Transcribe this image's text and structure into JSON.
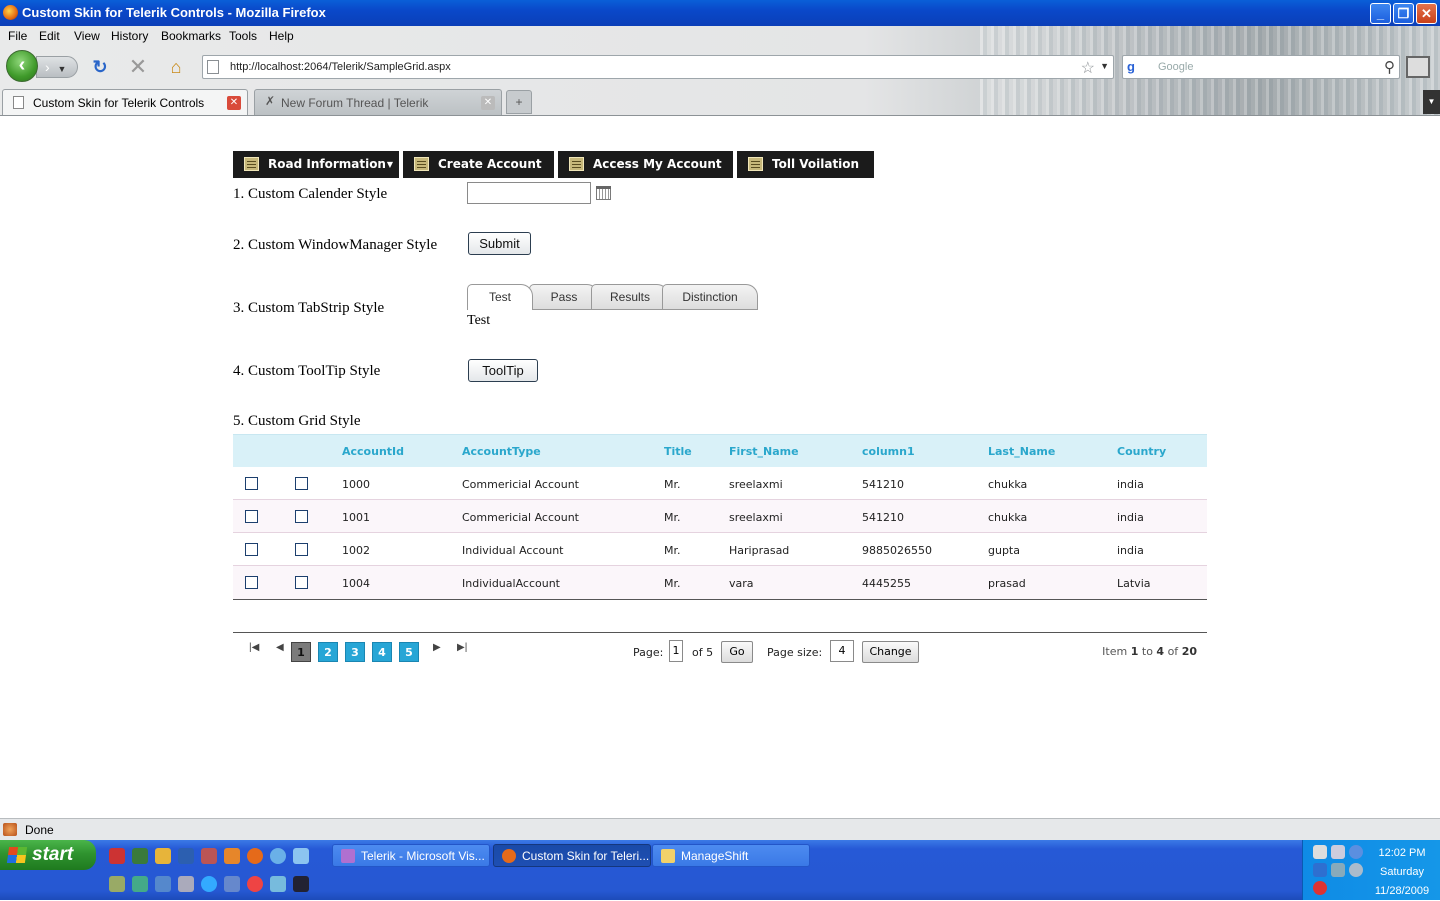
{
  "window": {
    "title": "Custom Skin for Telerik Controls - Mozilla Firefox",
    "minimize": "_",
    "maximize": "❐",
    "close": "✕"
  },
  "menubar": [
    "File",
    "Edit",
    "View",
    "History",
    "Bookmarks",
    "Tools",
    "Help"
  ],
  "navbar": {
    "url": "http://localhost:2064/Telerik/SampleGrid.aspx",
    "search_placeholder": "Google"
  },
  "tabs": [
    {
      "label": "Custom Skin for Telerik Controls",
      "active": true
    },
    {
      "label": "New Forum Thread | Telerik",
      "active": false
    }
  ],
  "nav_menu": [
    {
      "label": "Road Information",
      "has_dropdown": true
    },
    {
      "label": "Create Account",
      "has_dropdown": false
    },
    {
      "label": "Access My Account",
      "has_dropdown": false
    },
    {
      "label": "Toll Voilation",
      "has_dropdown": false
    }
  ],
  "sections": {
    "calendar_label": "1. Custom Calender Style",
    "calendar_value": "",
    "window_label": "2. Custom WindowManager Style",
    "submit_label": "Submit",
    "tabstrip_label": "3. Custom TabStrip Style",
    "tabstrip_tabs": [
      "Test",
      "Pass",
      "Results",
      "Distinction"
    ],
    "tabstrip_selected": "Test",
    "tabstrip_content": "Test",
    "tooltip_label": "4. Custom ToolTip Style",
    "tooltip_button": "ToolTip",
    "grid_label": "5. Custom Grid Style"
  },
  "grid": {
    "columns": [
      "AccountId",
      "AccountType",
      "Title",
      "First_Name",
      "column1",
      "Last_Name",
      "Country"
    ],
    "rows": [
      [
        "1000",
        "Commericial Account",
        "Mr.",
        "sreelaxmi",
        "541210",
        "chukka",
        "india"
      ],
      [
        "1001",
        "Commericial Account",
        "Mr.",
        "sreelaxmi",
        "541210",
        "chukka",
        "india"
      ],
      [
        "1002",
        "Individual Account",
        "Mr.",
        "Hariprasad",
        "9885026550",
        "gupta",
        "india"
      ],
      [
        "1004",
        "IndividualAccount",
        "Mr.",
        "vara",
        "4445255",
        "prasad",
        "Latvia"
      ]
    ]
  },
  "pager": {
    "pages": [
      "1",
      "2",
      "3",
      "4",
      "5"
    ],
    "current_page": "1",
    "page_label": "Page:",
    "page_value": "1",
    "of_text": "of 5",
    "go_label": "Go",
    "page_size_label": "Page size:",
    "page_size_value": "4",
    "change_label": "Change",
    "info_item": "Item",
    "info_from": "1",
    "info_to_word": "to",
    "info_to": "4",
    "info_of_word": "of",
    "info_total": "20"
  },
  "status": {
    "text": "Done"
  },
  "taskbar": {
    "start_label": "start",
    "items": [
      {
        "label": "Telerik - Microsoft Vis...",
        "active": false
      },
      {
        "label": "Custom Skin for Teleri...",
        "active": true
      },
      {
        "label": "ManageShift",
        "active": false
      }
    ],
    "clock_time": "12:02 PM",
    "clock_day": "Saturday",
    "clock_date": "11/28/2009"
  },
  "colors": {
    "grid_header_bg": "#d9f1f8",
    "grid_header_text": "#2aa7cc",
    "menu_bg": "#1b1b1b",
    "pager_active": "#27a6d6"
  }
}
